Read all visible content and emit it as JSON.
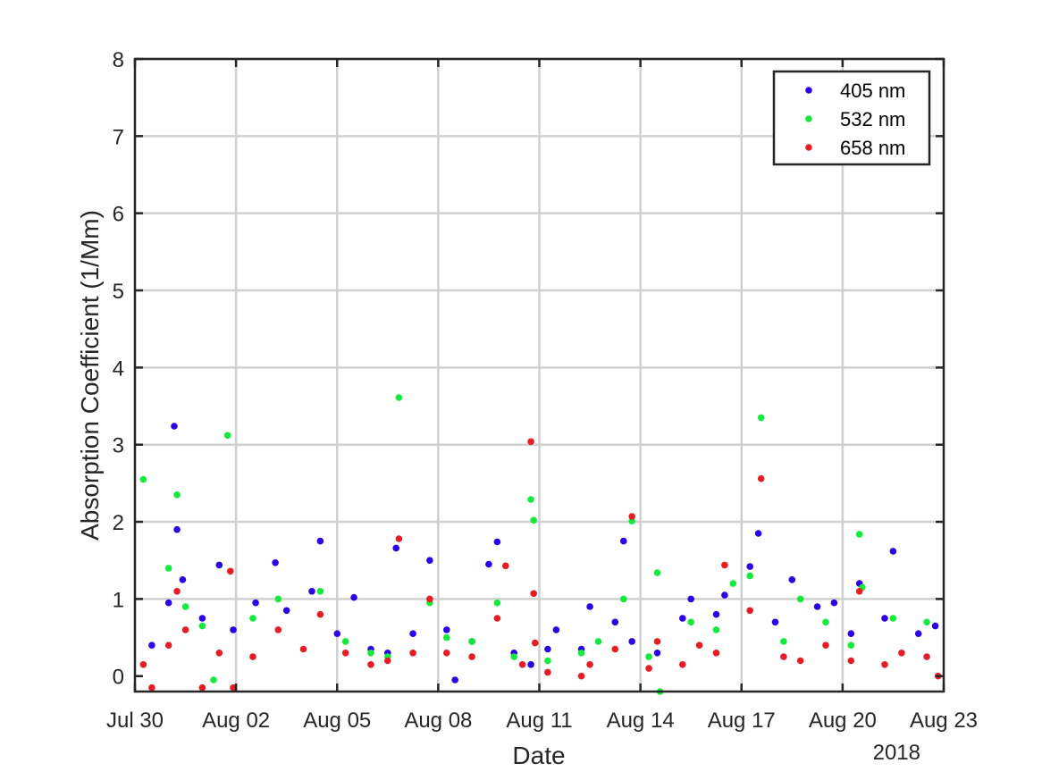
{
  "chart_data": {
    "type": "scatter",
    "title": "",
    "xlabel": "Date",
    "ylabel": "Absorption Coefficient (1/Mm)",
    "year_label": "2018",
    "xlim": [
      "2018-07-30",
      "2018-08-23"
    ],
    "ylim": [
      -0.2,
      8
    ],
    "x_ticks": [
      {
        "date": "2018-07-30",
        "label": "Jul 30"
      },
      {
        "date": "2018-08-02",
        "label": "Aug 02"
      },
      {
        "date": "2018-08-05",
        "label": "Aug 05"
      },
      {
        "date": "2018-08-08",
        "label": "Aug 08"
      },
      {
        "date": "2018-08-11",
        "label": "Aug 11"
      },
      {
        "date": "2018-08-14",
        "label": "Aug 14"
      },
      {
        "date": "2018-08-17",
        "label": "Aug 17"
      },
      {
        "date": "2018-08-20",
        "label": "Aug 20"
      },
      {
        "date": "2018-08-23",
        "label": "Aug 23"
      }
    ],
    "y_ticks": [
      0,
      1,
      2,
      3,
      4,
      5,
      6,
      7,
      8
    ],
    "grid": true,
    "legend": {
      "position": "top-right"
    },
    "series": [
      {
        "name": "405 nm",
        "color": "#2b00e6",
        "points": [
          [
            "2018-07-30T12:00",
            0.4
          ],
          [
            "2018-07-31T00:00",
            0.95
          ],
          [
            "2018-07-31T04:00",
            3.24
          ],
          [
            "2018-07-31T06:00",
            1.9
          ],
          [
            "2018-07-31T10:00",
            1.25
          ],
          [
            "2018-08-01T00:00",
            0.75
          ],
          [
            "2018-08-01T12:00",
            1.44
          ],
          [
            "2018-08-01T22:00",
            0.6
          ],
          [
            "2018-08-02T14:00",
            0.95
          ],
          [
            "2018-08-03T04:00",
            1.47
          ],
          [
            "2018-08-03T12:00",
            0.85
          ],
          [
            "2018-08-04T06:00",
            1.1
          ],
          [
            "2018-08-04T12:00",
            1.75
          ],
          [
            "2018-08-05T00:00",
            0.55
          ],
          [
            "2018-08-05T12:00",
            1.02
          ],
          [
            "2018-08-06T00:00",
            0.35
          ],
          [
            "2018-08-06T12:00",
            0.3
          ],
          [
            "2018-08-06T18:00",
            1.66
          ],
          [
            "2018-08-07T06:00",
            0.55
          ],
          [
            "2018-08-07T18:00",
            1.5
          ],
          [
            "2018-08-08T06:00",
            0.6
          ],
          [
            "2018-08-08T12:00",
            -0.05
          ],
          [
            "2018-08-09T00:00",
            0.45
          ],
          [
            "2018-08-09T12:00",
            1.45
          ],
          [
            "2018-08-09T18:00",
            1.74
          ],
          [
            "2018-08-10T06:00",
            0.3
          ],
          [
            "2018-08-10T18:00",
            0.15
          ],
          [
            "2018-08-11T06:00",
            0.35
          ],
          [
            "2018-08-11T12:00",
            0.6
          ],
          [
            "2018-08-12T06:00",
            0.35
          ],
          [
            "2018-08-12T12:00",
            0.9
          ],
          [
            "2018-08-13T06:00",
            0.7
          ],
          [
            "2018-08-13T12:00",
            1.75
          ],
          [
            "2018-08-13T18:00",
            0.45
          ],
          [
            "2018-08-14T12:00",
            0.3
          ],
          [
            "2018-08-15T06:00",
            0.75
          ],
          [
            "2018-08-15T12:00",
            1.0
          ],
          [
            "2018-08-16T06:00",
            0.8
          ],
          [
            "2018-08-16T12:00",
            1.05
          ],
          [
            "2018-08-17T06:00",
            1.42
          ],
          [
            "2018-08-17T12:00",
            1.85
          ],
          [
            "2018-08-18T00:00",
            0.7
          ],
          [
            "2018-08-18T12:00",
            1.25
          ],
          [
            "2018-08-19T06:00",
            0.9
          ],
          [
            "2018-08-19T18:00",
            0.95
          ],
          [
            "2018-08-20T06:00",
            0.55
          ],
          [
            "2018-08-20T12:00",
            1.2
          ],
          [
            "2018-08-21T06:00",
            0.75
          ],
          [
            "2018-08-21T12:00",
            1.62
          ],
          [
            "2018-08-22T06:00",
            0.55
          ],
          [
            "2018-08-22T18:00",
            0.65
          ]
        ]
      },
      {
        "name": "532 nm",
        "color": "#13eb3c",
        "points": [
          [
            "2018-07-30T06:00",
            2.55
          ],
          [
            "2018-07-31T00:00",
            1.4
          ],
          [
            "2018-07-31T06:00",
            2.35
          ],
          [
            "2018-07-31T12:00",
            0.9
          ],
          [
            "2018-08-01T00:00",
            0.65
          ],
          [
            "2018-08-01T08:00",
            -0.05
          ],
          [
            "2018-08-01T18:00",
            3.12
          ],
          [
            "2018-08-02T12:00",
            0.75
          ],
          [
            "2018-08-03T06:00",
            1.0
          ],
          [
            "2018-08-04T12:00",
            1.1
          ],
          [
            "2018-08-05T06:00",
            0.45
          ],
          [
            "2018-08-06T00:00",
            0.3
          ],
          [
            "2018-08-06T12:00",
            0.25
          ],
          [
            "2018-08-06T20:00",
            3.61
          ],
          [
            "2018-08-07T18:00",
            0.95
          ],
          [
            "2018-08-08T06:00",
            0.5
          ],
          [
            "2018-08-09T00:00",
            0.45
          ],
          [
            "2018-08-09T18:00",
            0.95
          ],
          [
            "2018-08-10T06:00",
            0.25
          ],
          [
            "2018-08-10T18:00",
            2.29
          ],
          [
            "2018-08-10T20:00",
            2.02
          ],
          [
            "2018-08-11T06:00",
            0.2
          ],
          [
            "2018-08-12T06:00",
            0.3
          ],
          [
            "2018-08-12T18:00",
            0.45
          ],
          [
            "2018-08-13T12:00",
            1.0
          ],
          [
            "2018-08-13T18:00",
            2.01
          ],
          [
            "2018-08-14T06:00",
            0.25
          ],
          [
            "2018-08-14T12:00",
            1.34
          ],
          [
            "2018-08-14T14:00",
            -0.2
          ],
          [
            "2018-08-15T12:00",
            0.7
          ],
          [
            "2018-08-16T06:00",
            0.6
          ],
          [
            "2018-08-16T18:00",
            1.2
          ],
          [
            "2018-08-17T06:00",
            1.3
          ],
          [
            "2018-08-17T14:00",
            3.35
          ],
          [
            "2018-08-18T06:00",
            0.45
          ],
          [
            "2018-08-18T18:00",
            1.0
          ],
          [
            "2018-08-19T12:00",
            0.7
          ],
          [
            "2018-08-20T06:00",
            0.4
          ],
          [
            "2018-08-20T12:00",
            1.84
          ],
          [
            "2018-08-20T14:00",
            1.15
          ],
          [
            "2018-08-21T12:00",
            0.75
          ],
          [
            "2018-08-22T12:00",
            0.7
          ]
        ]
      },
      {
        "name": "658 nm",
        "color": "#e81c24",
        "points": [
          [
            "2018-07-30T06:00",
            0.15
          ],
          [
            "2018-07-30T12:00",
            -0.15
          ],
          [
            "2018-07-31T00:00",
            0.4
          ],
          [
            "2018-07-31T06:00",
            1.1
          ],
          [
            "2018-07-31T12:00",
            0.6
          ],
          [
            "2018-08-01T00:00",
            -0.15
          ],
          [
            "2018-08-01T12:00",
            0.3
          ],
          [
            "2018-08-01T20:00",
            1.36
          ],
          [
            "2018-08-01T22:00",
            -0.15
          ],
          [
            "2018-08-02T12:00",
            0.25
          ],
          [
            "2018-08-03T06:00",
            0.6
          ],
          [
            "2018-08-04T00:00",
            0.35
          ],
          [
            "2018-08-04T12:00",
            0.8
          ],
          [
            "2018-08-05T06:00",
            0.3
          ],
          [
            "2018-08-06T00:00",
            0.15
          ],
          [
            "2018-08-06T12:00",
            0.2
          ],
          [
            "2018-08-06T20:00",
            1.78
          ],
          [
            "2018-08-07T06:00",
            0.3
          ],
          [
            "2018-08-07T18:00",
            1.0
          ],
          [
            "2018-08-08T06:00",
            0.3
          ],
          [
            "2018-08-09T00:00",
            0.25
          ],
          [
            "2018-08-09T18:00",
            0.75
          ],
          [
            "2018-08-10T00:00",
            1.43
          ],
          [
            "2018-08-10T12:00",
            0.15
          ],
          [
            "2018-08-10T18:00",
            3.04
          ],
          [
            "2018-08-10T20:00",
            1.07
          ],
          [
            "2018-08-10T21:00",
            0.43
          ],
          [
            "2018-08-11T06:00",
            0.05
          ],
          [
            "2018-08-12T06:00",
            0.0
          ],
          [
            "2018-08-12T12:00",
            0.15
          ],
          [
            "2018-08-13T06:00",
            0.35
          ],
          [
            "2018-08-13T18:00",
            2.07
          ],
          [
            "2018-08-14T06:00",
            0.1
          ],
          [
            "2018-08-14T12:00",
            0.45
          ],
          [
            "2018-08-15T06:00",
            0.15
          ],
          [
            "2018-08-15T18:00",
            0.4
          ],
          [
            "2018-08-16T06:00",
            0.3
          ],
          [
            "2018-08-16T12:00",
            1.44
          ],
          [
            "2018-08-17T06:00",
            0.85
          ],
          [
            "2018-08-17T14:00",
            2.56
          ],
          [
            "2018-08-18T06:00",
            0.25
          ],
          [
            "2018-08-18T18:00",
            0.2
          ],
          [
            "2018-08-19T12:00",
            0.4
          ],
          [
            "2018-08-20T06:00",
            0.2
          ],
          [
            "2018-08-20T12:00",
            1.1
          ],
          [
            "2018-08-21T06:00",
            0.15
          ],
          [
            "2018-08-21T18:00",
            0.3
          ],
          [
            "2018-08-22T12:00",
            0.25
          ],
          [
            "2018-08-22T20:00",
            0.0
          ]
        ]
      }
    ]
  }
}
